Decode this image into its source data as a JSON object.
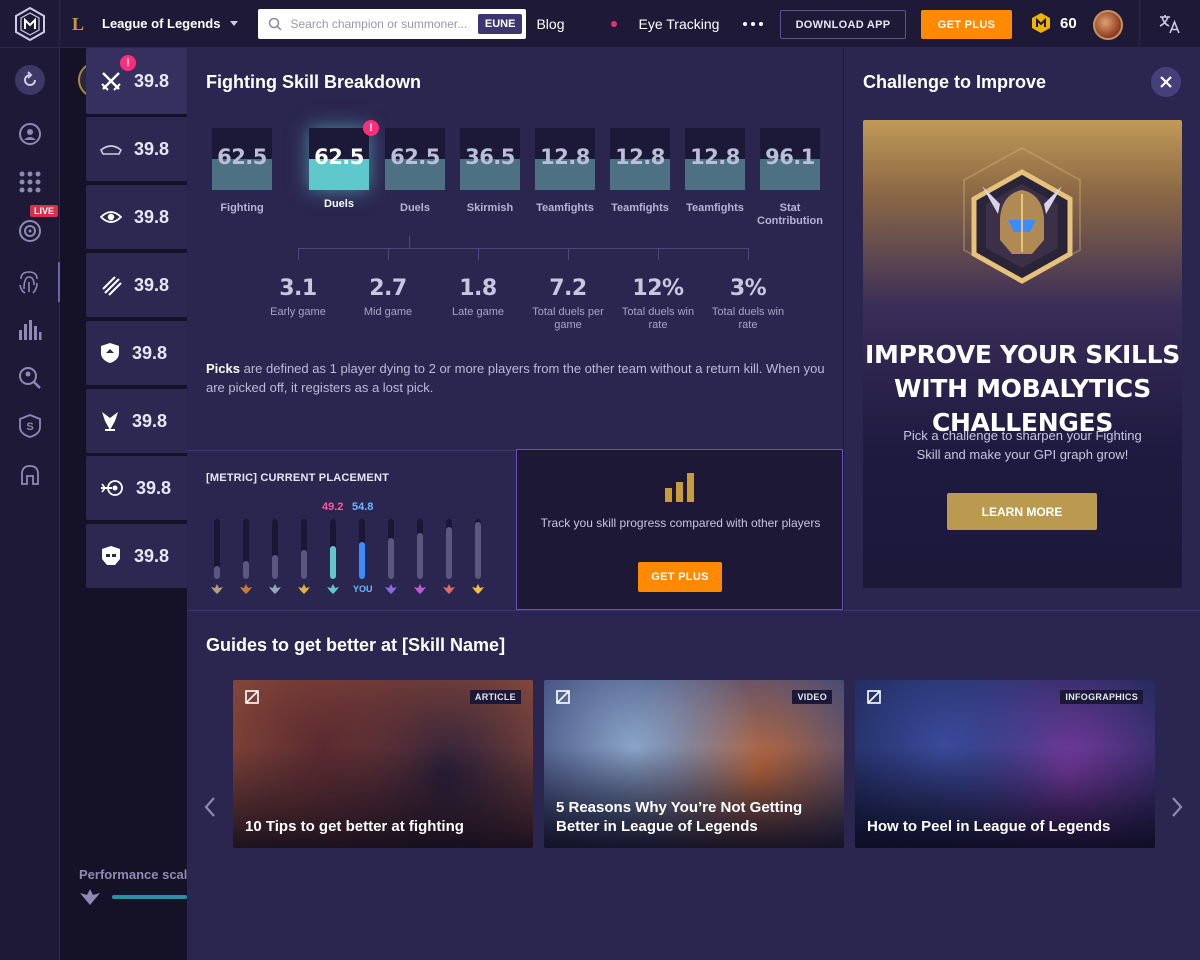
{
  "topbar": {
    "game_name": "League of Legends",
    "search_placeholder": "Search champion or summoner...",
    "region": "EUNE",
    "nav": [
      "Blog",
      "Eye Tracking"
    ],
    "download_label": "DOWNLOAD APP",
    "get_plus_label": "GET PLUS",
    "coins": "60"
  },
  "rail": {
    "live_label": "LIVE"
  },
  "skills": {
    "values": [
      "39.8",
      "39.8",
      "39.8",
      "39.8",
      "39.8",
      "39.8",
      "39.8",
      "39.8"
    ],
    "icons": [
      "swords-icon",
      "wards-icon",
      "eye-icon",
      "slash-icon",
      "shield-icon",
      "turret-icon",
      "target-icon",
      "helmet-icon"
    ],
    "alert": "!"
  },
  "breakdown": {
    "title": "Fighting Skill Breakdown",
    "metrics": [
      {
        "value": "62.5",
        "label": "Fighting",
        "fill": 0.5
      },
      {
        "value": "62.5",
        "label": "Duels",
        "fill": 0.5,
        "active": true
      },
      {
        "value": "62.5",
        "label": "Duels",
        "fill": 0.5
      },
      {
        "value": "36.5",
        "label": "Skirmish",
        "fill": 0.5
      },
      {
        "value": "12.8",
        "label": "Teamfights",
        "fill": 0.5
      },
      {
        "value": "12.8",
        "label": "Teamfights",
        "fill": 0.5
      },
      {
        "value": "12.8",
        "label": "Teamfights",
        "fill": 0.5
      },
      {
        "value": "96.1",
        "label": "Stat Contribution",
        "fill": 0.5
      }
    ],
    "sub_stats": [
      {
        "value": "3.1",
        "label": "Early game"
      },
      {
        "value": "2.7",
        "label": "Mid game"
      },
      {
        "value": "1.8",
        "label": "Late game"
      },
      {
        "value": "7.2",
        "label": "Total duels per game"
      },
      {
        "value": "12%",
        "label": "Total duels win rate"
      },
      {
        "value": "3%",
        "label": "Total duels win rate"
      }
    ],
    "desc_bold": "Picks",
    "desc_rest": " are defined as 1 player dying to 2 or more players from the other team without a return kill. When you are picked off, it registers as a lost pick."
  },
  "placement": {
    "title": "[METRIC] CURRENT PLACEMENT",
    "annotation_left": "49.2",
    "annotation_right": "54.8",
    "you_label": "YOU",
    "levels": [
      0.22,
      0.3,
      0.4,
      0.48,
      0.55,
      0.62,
      0.68,
      0.76,
      0.86,
      0.95
    ],
    "you_index": 5,
    "highlight_index": 4
  },
  "promo": {
    "text": "Track you skill progress compared with other players",
    "button": "GET PLUS"
  },
  "challenge": {
    "title": "Challenge to Improve",
    "headline": "IMPROVE YOUR SKILLS WITH MOBALYTICS CHALLENGES",
    "sub": "Pick a challenge to sharpen your Fighting Skill and make your GPI graph grow!",
    "button": "LEARN MORE"
  },
  "guides": {
    "title": "Guides to get better at [Skill Name]",
    "cards": [
      {
        "type": "ARTICLE",
        "title": "10 Tips to get better at fighting",
        "colors": [
          "#5a2a30",
          "#2a1f3a",
          "#8a4a3a"
        ]
      },
      {
        "type": "VIDEO",
        "title": "5 Reasons Why You’re Not Getting Better in League of Legends",
        "colors": [
          "#8aa4c8",
          "#c26a3a",
          "#3e4a7a"
        ]
      },
      {
        "type": "INFOGRAPHICS",
        "title": "How to Peel in League of Legends",
        "colors": [
          "#3a4a9a",
          "#7a3aa0",
          "#1e2a5a"
        ]
      }
    ]
  },
  "background": {
    "performance_label": "Performance scale"
  },
  "colors": {
    "accent_orange": "#ff8a00",
    "accent_gold": "#b99a4f",
    "alert_pink": "#ff2d7a",
    "active_teal": "#5fc8cc",
    "you_blue": "#3a8cff"
  }
}
